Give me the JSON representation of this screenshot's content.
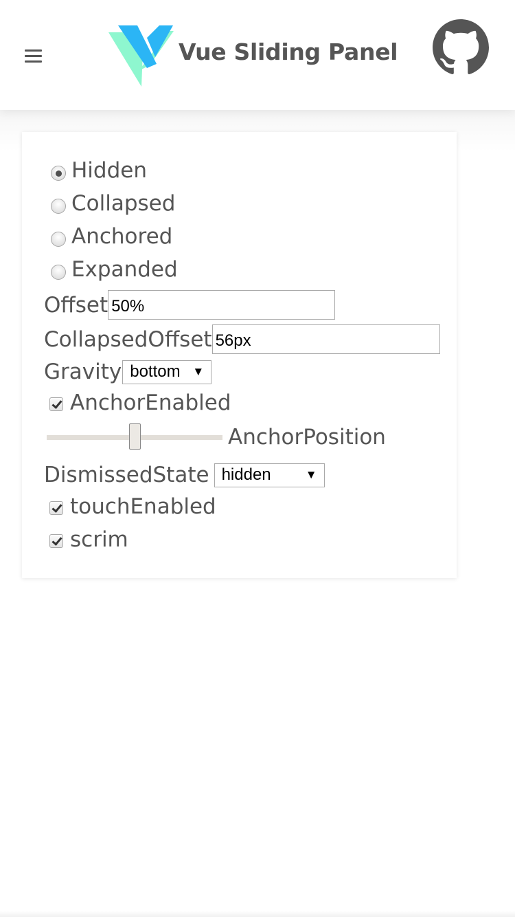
{
  "header": {
    "title": "Vue Sliding Panel",
    "menu_icon": "hamburger-menu-icon",
    "logo_icon": "vue-sliding-panel-logo",
    "github_icon": "github-icon",
    "logo_colors": [
      "#2bb5f5",
      "#8ef7cf"
    ]
  },
  "panel": {
    "states": [
      {
        "label": "Hidden",
        "checked": true
      },
      {
        "label": "Collapsed",
        "checked": false
      },
      {
        "label": "Anchored",
        "checked": false
      },
      {
        "label": "Expanded",
        "checked": false
      }
    ],
    "offset": {
      "label": "Offset",
      "value": "50%"
    },
    "collapsed_offset": {
      "label": "CollapsedOffset",
      "value": "56px"
    },
    "gravity": {
      "label": "Gravity",
      "value": "bottom"
    },
    "anchor_enabled": {
      "label": "AnchorEnabled",
      "checked": true
    },
    "anchor_position": {
      "label": "AnchorPosition",
      "value": 0.5
    },
    "dismissed_state": {
      "label": "DismissedState",
      "value": "hidden"
    },
    "touch_enabled": {
      "label": "touchEnabled",
      "checked": true
    },
    "scrim": {
      "label": "scrim",
      "checked": true
    }
  },
  "colors": {
    "text": "#555555",
    "background": "#ffffff"
  }
}
